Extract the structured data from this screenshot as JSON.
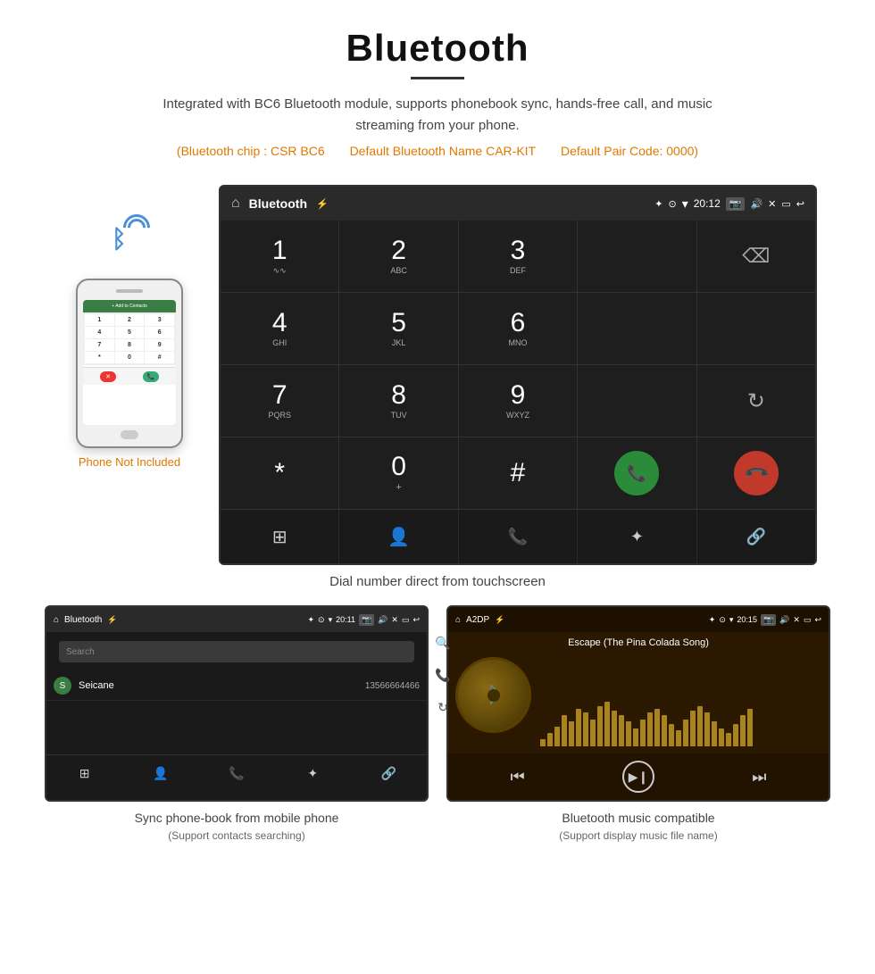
{
  "page": {
    "title": "Bluetooth",
    "subtitle": "Integrated with BC6 Bluetooth module, supports phonebook sync, hands-free call, and music streaming from your phone.",
    "bt_chip": "(Bluetooth chip : CSR BC6",
    "bt_name": "Default Bluetooth Name CAR-KIT",
    "bt_pair": "Default Pair Code: 0000)",
    "phone_not_included": "Phone Not Included",
    "caption_main": "Dial number direct from touchscreen",
    "caption_left": "Sync phone-book from mobile phone",
    "caption_left_sub": "(Support contacts searching)",
    "caption_right": "Bluetooth music compatible",
    "caption_right_sub": "(Support display music file name)"
  },
  "topbar": {
    "title": "Bluetooth",
    "time": "20:12",
    "usb_icon": "⚡",
    "bt_icon": "✦",
    "loc_icon": "⊙",
    "wifi_icon": "▾",
    "home_icon": "⌂",
    "camera_icon": "📷",
    "vol_icon": "🔊",
    "back_icon": "↩"
  },
  "dialpad": {
    "keys": [
      {
        "num": "1",
        "letters": "∿∿"
      },
      {
        "num": "2",
        "letters": "ABC"
      },
      {
        "num": "3",
        "letters": "DEF"
      },
      {
        "num": "",
        "letters": ""
      },
      {
        "num": "⌫",
        "letters": ""
      },
      {
        "num": "4",
        "letters": "GHI"
      },
      {
        "num": "5",
        "letters": "JKL"
      },
      {
        "num": "6",
        "letters": "MNO"
      },
      {
        "num": "",
        "letters": ""
      },
      {
        "num": "",
        "letters": ""
      },
      {
        "num": "7",
        "letters": "PQRS"
      },
      {
        "num": "8",
        "letters": "TUV"
      },
      {
        "num": "9",
        "letters": "WXYZ"
      },
      {
        "num": "",
        "letters": ""
      },
      {
        "num": "⟳",
        "letters": ""
      },
      {
        "num": "*",
        "letters": ""
      },
      {
        "num": "0",
        "letters": "+"
      },
      {
        "num": "#",
        "letters": ""
      },
      {
        "num": "call",
        "letters": ""
      },
      {
        "num": "end",
        "letters": ""
      }
    ]
  },
  "toolbar": {
    "buttons": [
      "⊞",
      "👤",
      "📞",
      "✦",
      "🔗"
    ]
  },
  "contacts": {
    "topbar_title": "Bluetooth",
    "time": "20:11",
    "search_placeholder": "Search",
    "contact": {
      "letter": "S",
      "name": "Seicane",
      "number": "13566664466"
    },
    "toolbar_icons": [
      "⊞",
      "👤",
      "📞",
      "✦",
      "🔗"
    ]
  },
  "music": {
    "topbar_title": "A2DP",
    "time": "20:15",
    "song_title": "Escape (The Pina Colada Song)",
    "eq_bars": [
      8,
      15,
      22,
      35,
      28,
      42,
      38,
      30,
      45,
      50,
      40,
      35,
      28,
      20,
      30,
      38,
      42,
      35,
      25,
      18,
      30,
      40,
      45,
      38,
      28,
      20,
      15,
      25,
      35,
      42
    ],
    "controls": {
      "prev": "⏮",
      "play": "⏵❙",
      "next": "⏭"
    }
  }
}
